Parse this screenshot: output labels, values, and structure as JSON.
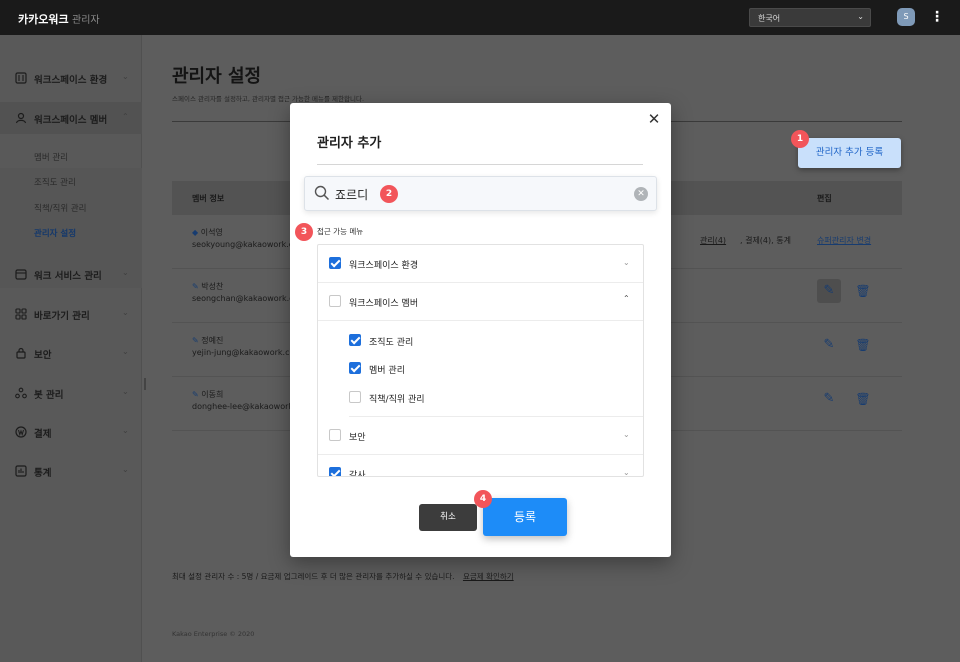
{
  "topbar": {
    "brand": "카카오워크",
    "brand_sub": "관리자",
    "language": "한국어",
    "avatar_initial": "S"
  },
  "sidebar": {
    "items": [
      {
        "label": "워크스페이스 환경",
        "icon": "sliders-icon"
      },
      {
        "label": "워크스페이스 멤버",
        "icon": "user-icon"
      },
      {
        "label": "워크 서비스 관리",
        "icon": "calendar-icon"
      },
      {
        "label": "바로가기 관리",
        "icon": "grid-icon"
      },
      {
        "label": "보안",
        "icon": "lock-icon"
      },
      {
        "label": "봇 관리",
        "icon": "bot-icon"
      },
      {
        "label": "결제",
        "icon": "won-icon"
      },
      {
        "label": "통계",
        "icon": "chart-icon"
      }
    ],
    "sub_items": [
      "멤버 관리",
      "조직도 관리",
      "직책/직위 관리",
      "관리자 설정"
    ]
  },
  "main": {
    "title": "관리자 설정",
    "description": "스페이스 관리자를 설정하고, 관리자별 접근 가능한 메뉴를 제한합니다.",
    "add_button": "관리자 추가 등록",
    "columns": {
      "member": "멤버 정보",
      "edit": "편집"
    },
    "rows": [
      {
        "name": "이석영",
        "email": "seokyoung@kakaowork.com",
        "perm": "관리(4)",
        "perm_tail": ", 결제(4), 통계",
        "super_link": "슈퍼관리자 변경"
      },
      {
        "name": "박성찬",
        "email": "seongchan@kakaowork.com"
      },
      {
        "name": "정예진",
        "email": "yejin-jung@kakaowork.com"
      },
      {
        "name": "이동희",
        "email": "donghee-lee@kakaowork.com"
      }
    ],
    "footer_note": "최대 설정 관리자 수 : 5명 / 요금제 업그레이드 후 더 많은 관리자를 추가하실 수 있습니다.",
    "footer_link": "요금제 확인하기",
    "copyright": "Kakao Enterprise © 2020"
  },
  "modal": {
    "title": "관리자 추가",
    "search_value": "죠르디",
    "menu_label": "접근 가능 메뉴",
    "menus": [
      {
        "label": "워크스페이스 환경",
        "checked": true
      },
      {
        "label": "워크스페이스 멤버",
        "checked": false
      },
      {
        "label": "조직도 관리",
        "checked": true
      },
      {
        "label": "멤버 관리",
        "checked": true
      },
      {
        "label": "직책/직위 관리",
        "checked": false
      },
      {
        "label": "보안",
        "checked": false
      },
      {
        "label": "감사",
        "checked": true
      }
    ],
    "cancel": "취소",
    "register": "등록"
  },
  "badges": [
    "1",
    "2",
    "3",
    "4"
  ],
  "colors": {
    "accent": "#1d8cf8",
    "badge": "#f2555a"
  }
}
